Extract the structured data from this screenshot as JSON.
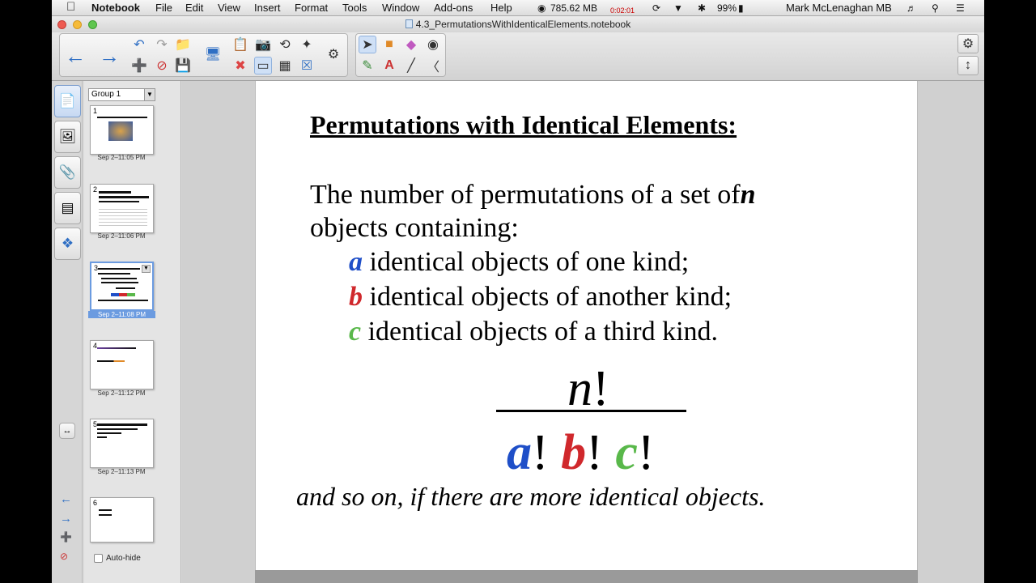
{
  "menubar": {
    "app_name": "Notebook",
    "menus": [
      "File",
      "Edit",
      "View",
      "Insert",
      "Format",
      "Tools",
      "Window",
      "Add-ons",
      "Help"
    ],
    "memory": "785.62 MB",
    "timer": "0:02:01",
    "battery": "99%",
    "user": "Mark McLenaghan MB"
  },
  "window": {
    "title": "4.3_PermutationsWithIdenticalElements.notebook"
  },
  "sorter": {
    "group_label": "Group 1",
    "thumbnails": [
      {
        "num": "1",
        "time": "Sep 2–11:05 PM"
      },
      {
        "num": "2",
        "time": "Sep 2–11:06 PM"
      },
      {
        "num": "3",
        "time": "Sep 2–11:08 PM"
      },
      {
        "num": "4",
        "time": "Sep 2–11:12 PM"
      },
      {
        "num": "5",
        "time": "Sep 2–11:13 PM"
      },
      {
        "num": "6",
        "time": ""
      }
    ],
    "autohide_label": "Auto-hide"
  },
  "slide": {
    "title": "Permutations with Identical Elements:",
    "intro_line1": "The number of permutations of a set of",
    "intro_var": "n",
    "intro_line2": "objects containing:",
    "kinds": [
      {
        "var": "a",
        "text": " identical objects of one kind;",
        "color": "#1f4fc8"
      },
      {
        "var": "b",
        "text": " identical objects of another kind;",
        "color": "#d0282c"
      },
      {
        "var": "c",
        "text": " identical objects of a third kind.",
        "color": "#59b84a"
      }
    ],
    "formula_numerator_var": "n",
    "bang": "!",
    "footnote": "and so on, if there are more identical objects."
  },
  "colors": {
    "a": "#1f4fc8",
    "b": "#d0282c",
    "c": "#59b84a",
    "accent": "#2f6fc4"
  }
}
